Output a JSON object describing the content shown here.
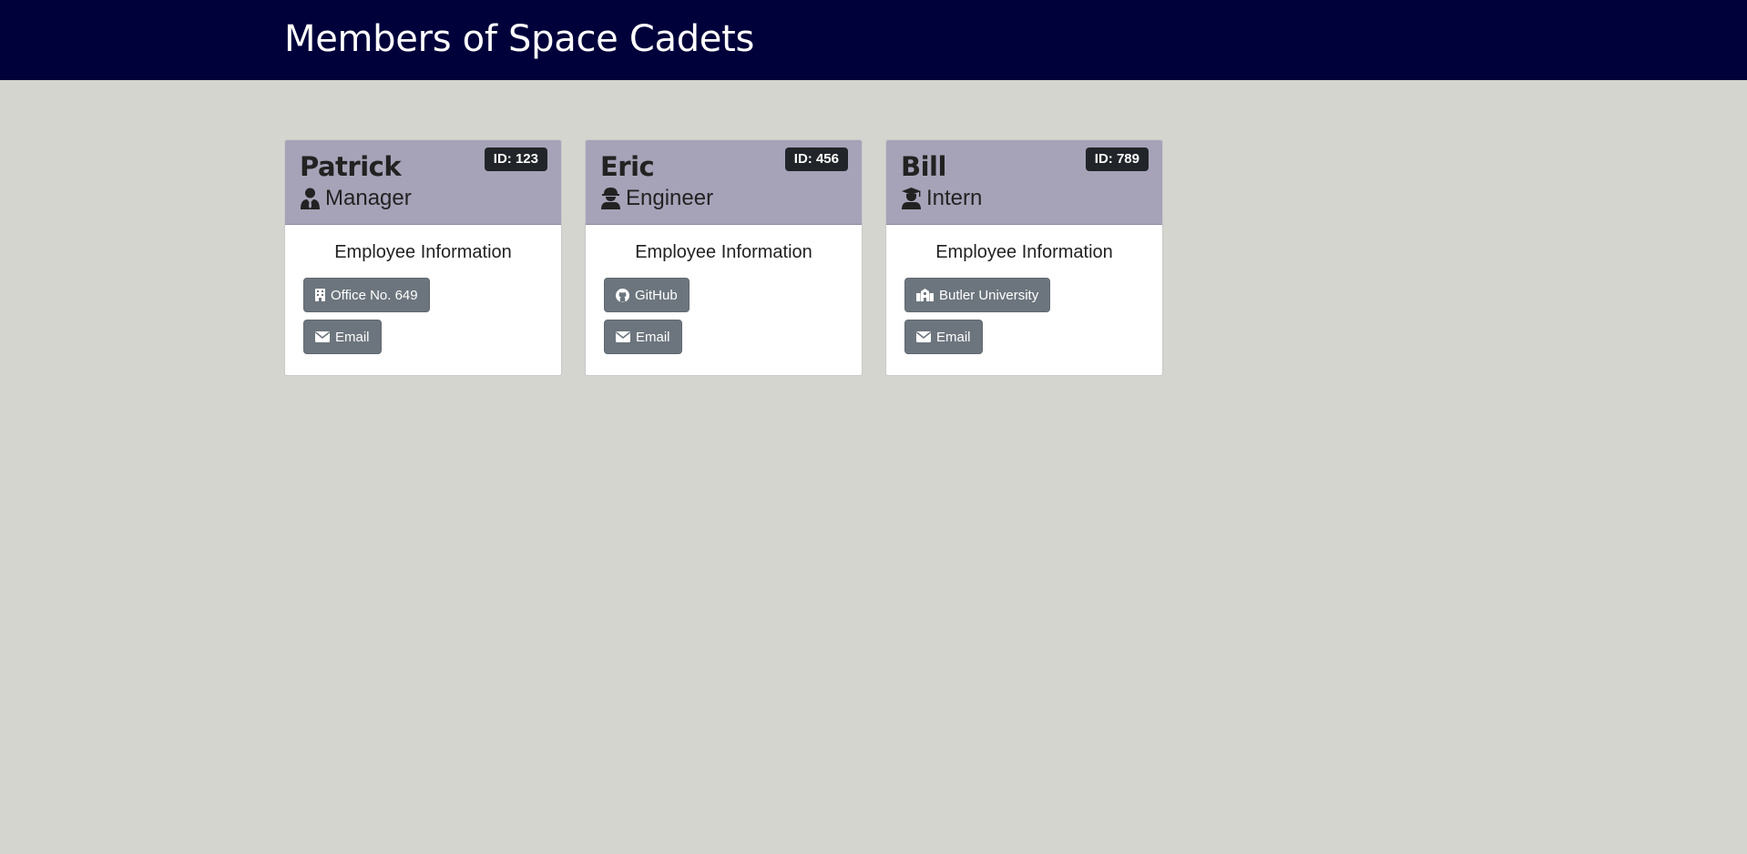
{
  "header": {
    "title": "Members of Space Cadets"
  },
  "section": {
    "info_title": "Employee Information"
  },
  "colors": {
    "header_bg": "#00003b",
    "page_bg": "#d4d5cf",
    "card_head_bg": "#a6a3b8",
    "badge_bg": "#212529",
    "button_bg": "#6c757d"
  },
  "cards": [
    {
      "name": "Patrick",
      "id_label": "ID: 123",
      "role": "Manager",
      "role_icon": "user-tie-icon",
      "primary": {
        "label": "Office No. 649",
        "icon": "building-icon"
      },
      "email": {
        "label": "Email",
        "icon": "envelope-icon"
      }
    },
    {
      "name": "Eric",
      "id_label": "ID: 456",
      "role": "Engineer",
      "role_icon": "hard-hat-icon",
      "primary": {
        "label": "GitHub",
        "icon": "github-icon"
      },
      "email": {
        "label": "Email",
        "icon": "envelope-icon"
      }
    },
    {
      "name": "Bill",
      "id_label": "ID: 789",
      "role": "Intern",
      "role_icon": "graduate-icon",
      "primary": {
        "label": "Butler University",
        "icon": "school-icon"
      },
      "email": {
        "label": "Email",
        "icon": "envelope-icon"
      }
    }
  ]
}
